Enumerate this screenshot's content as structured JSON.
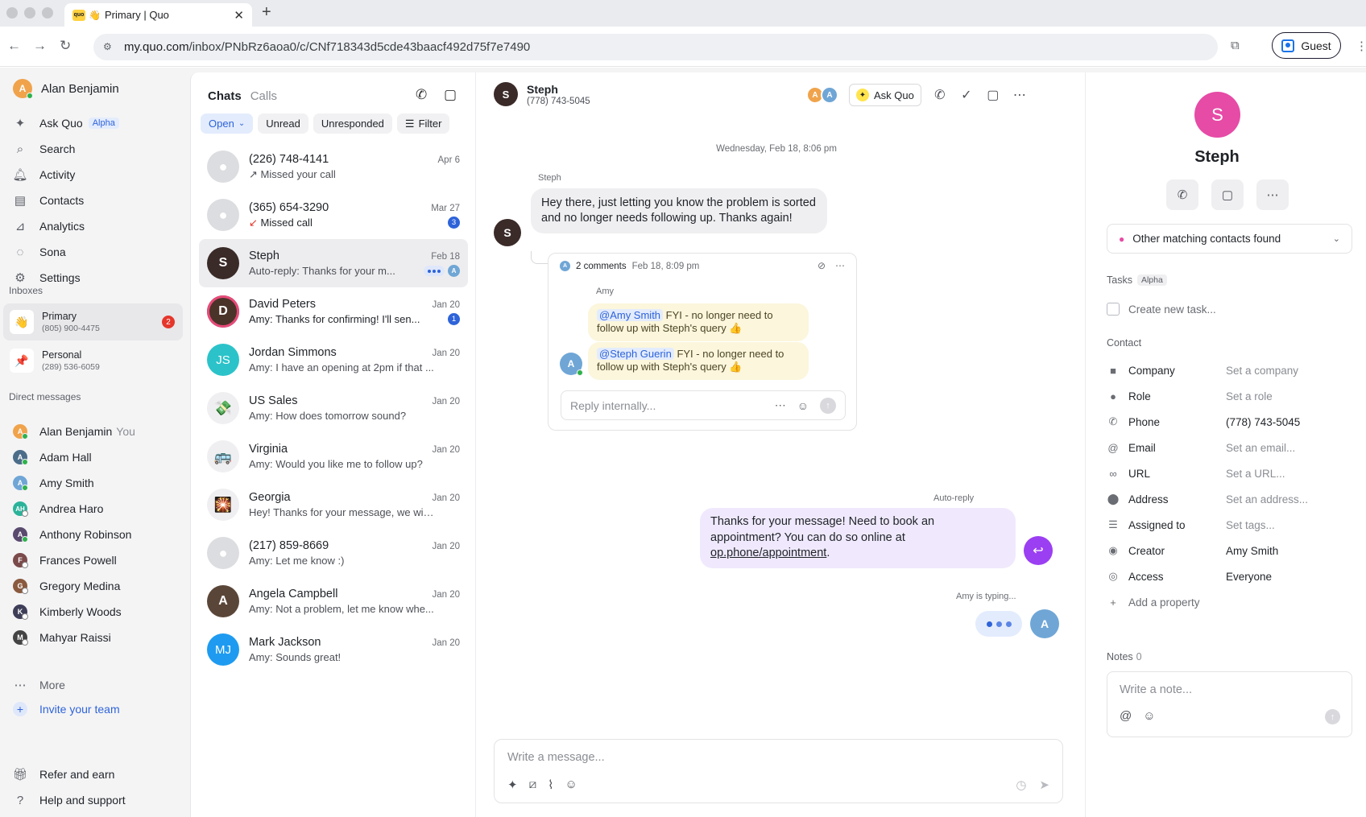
{
  "browser": {
    "tab_title": "Primary | Quo",
    "favicon_text": "quo",
    "url_domain": "my.quo.com",
    "url_path": "/inbox/PNbRz6aoa0/c/CNf718343d5cde43baacf492d75f7e7490",
    "profile_label": "Guest"
  },
  "sidebar": {
    "user_name": "Alan Benjamin",
    "nav": [
      {
        "label": "Ask Quo",
        "badge": "Alpha",
        "icon": "sparkle-icon"
      },
      {
        "label": "Search",
        "icon": "search-icon"
      },
      {
        "label": "Activity",
        "icon": "bell-icon"
      },
      {
        "label": "Contacts",
        "icon": "contacts-icon"
      },
      {
        "label": "Analytics",
        "icon": "analytics-icon"
      },
      {
        "label": "Sona",
        "icon": "sona-icon"
      },
      {
        "label": "Settings",
        "icon": "gear-icon"
      }
    ],
    "inboxes_label": "Inboxes",
    "inboxes": [
      {
        "name": "Primary",
        "number": "(805) 900-4475",
        "badge": "2",
        "emoji": "👋"
      },
      {
        "name": "Personal",
        "number": "(289) 536-6059",
        "emoji": "📌"
      }
    ],
    "dm_label": "Direct messages",
    "dms": [
      {
        "name": "Alan Benjamin",
        "suffix": "You"
      },
      {
        "name": "Adam Hall"
      },
      {
        "name": "Amy Smith"
      },
      {
        "name": "Andrea Haro"
      },
      {
        "name": "Anthony Robinson"
      },
      {
        "name": "Frances Powell"
      },
      {
        "name": "Gregory Medina"
      },
      {
        "name": "Kimberly Woods"
      },
      {
        "name": "Mahyar Raissi"
      }
    ],
    "more_label": "More",
    "invite_label": "Invite your team",
    "refer_label": "Refer and earn",
    "help_label": "Help and support"
  },
  "convlist": {
    "tab_chats": "Chats",
    "tab_calls": "Calls",
    "filters": [
      "Open",
      "Unread",
      "Unresponded",
      "Filter"
    ],
    "items": [
      {
        "name": "(226) 748-4141",
        "date": "Apr 6",
        "preview": "Missed your call",
        "prefix": "↗"
      },
      {
        "name": "(365) 654-3290",
        "date": "Mar 27",
        "preview": "Missed call",
        "prefix": "↙",
        "badge": "3"
      },
      {
        "name": "Steph",
        "date": "Feb 18",
        "preview": "Auto-reply: Thanks for your m..."
      },
      {
        "name": "David Peters",
        "date": "Jan 20",
        "preview": "Amy: Thanks for confirming! I'll sen...",
        "badge": "1"
      },
      {
        "name": "Jordan Simmons",
        "date": "Jan 20",
        "preview": "Amy: I have an opening at 2pm if that ...",
        "initials": "JS"
      },
      {
        "name": "US Sales",
        "date": "Jan 20",
        "preview": "Amy: How does tomorrow sound?",
        "emoji": "💸"
      },
      {
        "name": "Virginia",
        "date": "Jan 20",
        "preview": "Amy: Would you like me to follow up?",
        "emoji": "🚌"
      },
      {
        "name": "Georgia",
        "date": "Jan 20",
        "preview": "Hey! Thanks for your message, we will...",
        "emoji": "🎇"
      },
      {
        "name": "(217) 859-8669",
        "date": "Jan 20",
        "preview": "Amy: Let me know :)"
      },
      {
        "name": "Angela Campbell",
        "date": "Jan 20",
        "preview": "Amy: Not a problem, let me know whe..."
      },
      {
        "name": "Mark Jackson",
        "date": "Jan 20",
        "preview": "Amy: Sounds great!",
        "initials": "MJ"
      }
    ]
  },
  "chat": {
    "contact_name": "Steph",
    "contact_phone": "(778) 743-5045",
    "ask_quo_label": "Ask Quo",
    "date_separator": "Wednesday, Feb 18, 8:06 pm",
    "incoming_sender": "Steph",
    "incoming_text": "Hey there, just letting you know the problem is sorted and no longer needs following up. Thanks again!",
    "thread": {
      "count_label": "2 comments",
      "date": "Feb 18, 8:09 pm",
      "author": "Amy",
      "notes": [
        {
          "mention": "@Amy Smith",
          "text": "FYI - no longer need to follow up with Steph's query 👍"
        },
        {
          "mention": "@Steph Guerin",
          "text": "FYI - no longer need to follow up with Steph's query 👍"
        }
      ],
      "reply_placeholder": "Reply internally..."
    },
    "autoreply_label": "Auto-reply",
    "autoreply_text": "Thanks for your message! Need to book an appointment? You can do so online at ",
    "autoreply_link": "op.phone/appointment",
    "autoreply_end": ".",
    "typing_label": "Amy is typing...",
    "composer_placeholder": "Write a message..."
  },
  "rpanel": {
    "initial": "S",
    "name": "Steph",
    "match_text": "Other matching contacts found",
    "tasks_label": "Tasks",
    "tasks_badge": "Alpha",
    "task_placeholder": "Create new task...",
    "contact_label": "Contact",
    "properties": [
      {
        "label": "Company",
        "value": "Set a company",
        "icon": "briefcase-icon"
      },
      {
        "label": "Role",
        "value": "Set a role",
        "icon": "person-icon"
      },
      {
        "label": "Phone",
        "value": "(778) 743-5045",
        "icon": "phone-icon",
        "set": true
      },
      {
        "label": "Email",
        "value": "Set an email...",
        "icon": "at-icon"
      },
      {
        "label": "URL",
        "value": "Set a URL...",
        "icon": "link-icon"
      },
      {
        "label": "Address",
        "value": "Set an address...",
        "icon": "pin-icon"
      },
      {
        "label": "Assigned to",
        "value": "Set tags...",
        "icon": "list-icon"
      },
      {
        "label": "Creator",
        "value": "Amy Smith",
        "icon": "user-circle-icon",
        "set": true
      },
      {
        "label": "Access",
        "value": "Everyone",
        "icon": "eye-icon",
        "set": true
      }
    ],
    "add_property": "Add a property",
    "notes_label": "Notes",
    "notes_count": "0",
    "note_placeholder": "Write a note..."
  },
  "colors": {
    "accent_blue": "#2e63d9",
    "autoreply_purple": "#9b3ff2",
    "contact_pink": "#e64ba6",
    "badge_red": "#e5362b"
  }
}
